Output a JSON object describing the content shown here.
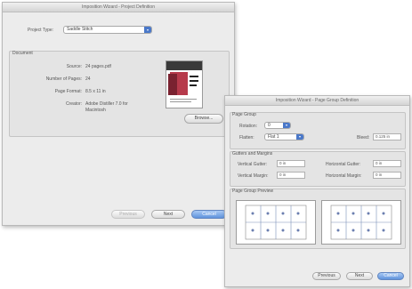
{
  "window1": {
    "title": "Imposition Wizard - Project Definition",
    "project_type_label": "Project Type:",
    "project_type_value": "Saddle Stitch",
    "document_group_label": "Document",
    "fields": [
      {
        "label": "Source:",
        "value": "24 pages.pdf"
      },
      {
        "label": "Number of Pages:",
        "value": "24"
      },
      {
        "label": "Page Format:",
        "value": "8.5 x 11 in"
      },
      {
        "label": "Creator:",
        "value": "Adobe Distiller 7.0 for Macintosh"
      }
    ],
    "browse_label": "Browse...",
    "previous_label": "Previous",
    "next_label": "Next",
    "cancel_label": "Cancel"
  },
  "window2": {
    "title": "Imposition Wizard - Page Group Definition",
    "page_group_label": "Page Group",
    "rotation_label": "Rotation:",
    "rotation_value": "0",
    "flatten_label": "Flatten:",
    "flatten_value": "Flat 1",
    "bleed_label": "Bleed:",
    "bleed_value": "0.125 in",
    "gutters_label": "Gutters and Margins",
    "vertical_gutter_label": "Vertical Gutter:",
    "vertical_gutter_value": "0 in",
    "horizontal_gutter_label": "Horizontal Gutter:",
    "horizontal_gutter_value": "0 in",
    "vertical_margin_label": "Vertical Margin:",
    "vertical_margin_value": "0 in",
    "horizontal_margin_label": "Horizontal Margin:",
    "horizontal_margin_value": "0 in",
    "preview_label": "Page Group Preview",
    "previous_label": "Previous",
    "next_label": "Next",
    "cancel_label": "Cancel"
  },
  "colors": {
    "accent": "#5f93dc",
    "window_bg": "#ececec"
  }
}
